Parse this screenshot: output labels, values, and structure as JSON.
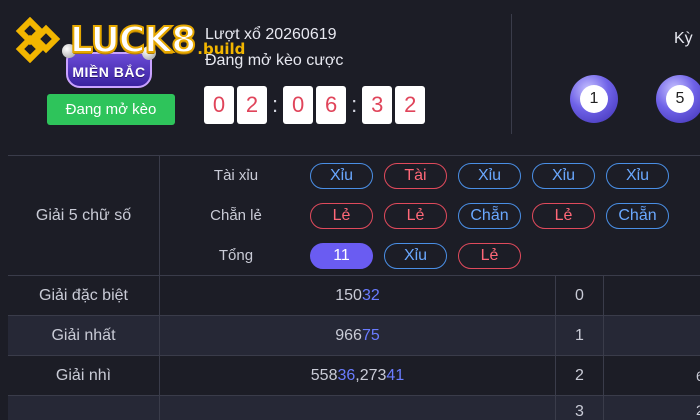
{
  "logo": {
    "brand": "LUCK8",
    "suffix": ".build",
    "badge_text": "MIỀN BẮC"
  },
  "header": {
    "draw_label": "Lượt xổ 20260619",
    "status_text": "Đang mở kèo cược",
    "status_button": "Đang mở kèo",
    "countdown": [
      "0",
      "2",
      "6",
      "3",
      "2"
    ],
    "countdown_prefix_digit": "0",
    "period_label": "Kỳ",
    "balls": [
      "1",
      "5"
    ]
  },
  "five_digit": {
    "label": "Giải 5 chữ số",
    "rows": [
      {
        "label": "Tài xỉu",
        "options": [
          {
            "text": "Xỉu",
            "color": "blue"
          },
          {
            "text": "Tài",
            "color": "red"
          },
          {
            "text": "Xỉu",
            "color": "blue"
          },
          {
            "text": "Xỉu",
            "color": "blue"
          },
          {
            "text": "Xỉu",
            "color": "blue"
          }
        ]
      },
      {
        "label": "Chẵn lẻ",
        "options": [
          {
            "text": "Lẻ",
            "color": "red"
          },
          {
            "text": "Lẻ",
            "color": "red"
          },
          {
            "text": "Chẵn",
            "color": "blue"
          },
          {
            "text": "Lẻ",
            "color": "red"
          },
          {
            "text": "Chẵn",
            "color": "blue"
          }
        ]
      },
      {
        "label": "Tổng",
        "options": [
          {
            "text": "11",
            "color": "active"
          },
          {
            "text": "Xỉu",
            "color": "blue"
          },
          {
            "text": "Lẻ",
            "color": "red"
          }
        ]
      }
    ]
  },
  "prizes": [
    {
      "label": "Giải đặc biệt",
      "plain": "150",
      "highlight": "32",
      "rest": "",
      "index": "0",
      "tail": ""
    },
    {
      "label": "Giải nhất",
      "plain": "966",
      "highlight": "75",
      "rest": "",
      "index": "1",
      "tail": ""
    },
    {
      "label": "Giải nhì",
      "plain": "558",
      "highlight": "36",
      "rest": ",273",
      "rest_hl": "41",
      "index": "2",
      "tail": "6"
    },
    {
      "label": "",
      "plain": "",
      "highlight": "",
      "rest": "",
      "index": "3",
      "tail": "2"
    }
  ],
  "colors": {
    "accent_blue": "#6aa8ff",
    "accent_red": "#ff6878",
    "active_purple": "#6a5cf2",
    "status_green": "#2ec45b",
    "highlight_digit": "#6a7cff"
  }
}
